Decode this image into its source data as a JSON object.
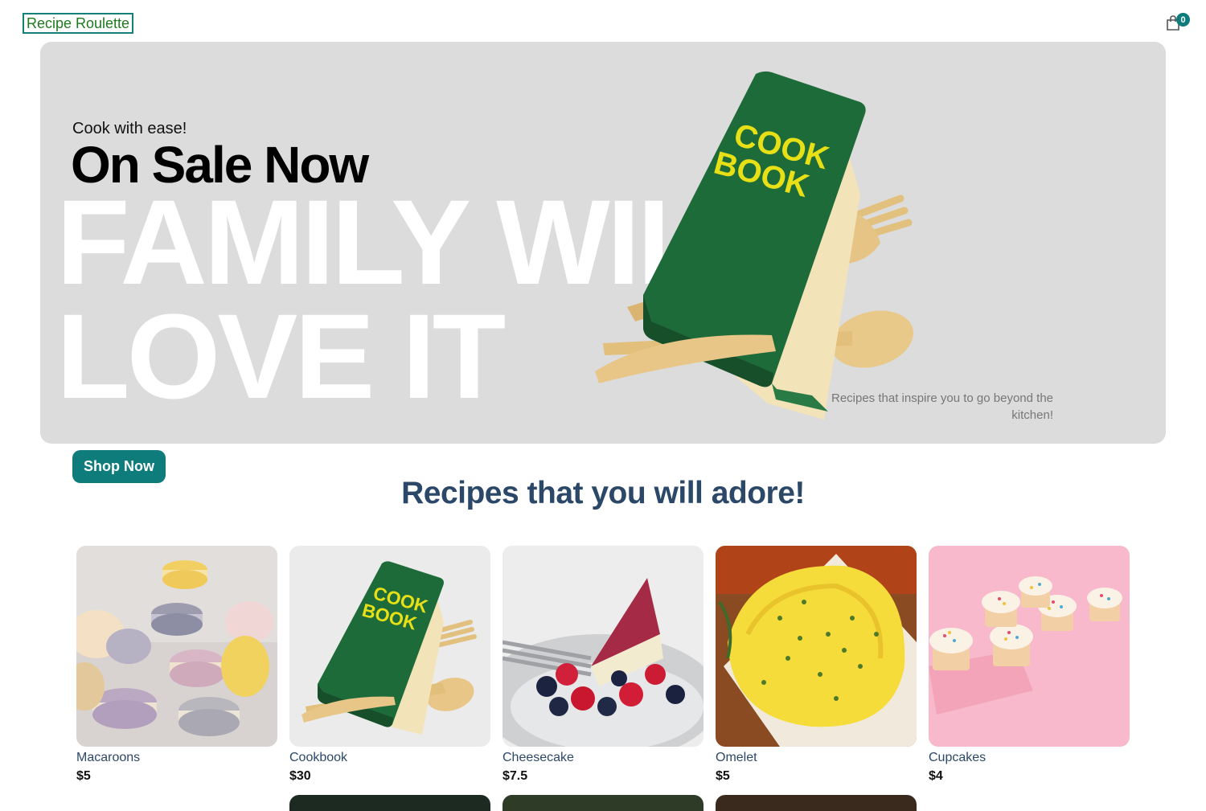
{
  "nav": {
    "logo": "Recipe Roulette",
    "cart_count": "0",
    "cart_icon": "shopping-bag-icon"
  },
  "hero": {
    "small_text": "Cook with ease!",
    "mid_text": "On Sale Now",
    "large_text": "FAMILY WILL LOVE IT",
    "book_text_line1": "COOK",
    "book_text_line2": "BOOK",
    "description": "Recipes that inspire you to go beyond the kitchen!",
    "background": "#dcdcdc"
  },
  "cta": {
    "label": "Shop Now",
    "color": "#0e7c7b"
  },
  "section": {
    "title": "Recipes that you will adore!"
  },
  "products": [
    {
      "name": "Macaroons",
      "price": "$5"
    },
    {
      "name": "Cookbook",
      "price": "$30"
    },
    {
      "name": "Cheesecake",
      "price": "$7.5"
    },
    {
      "name": "Omelet",
      "price": "$5"
    },
    {
      "name": "Cupcakes",
      "price": "$4"
    }
  ]
}
